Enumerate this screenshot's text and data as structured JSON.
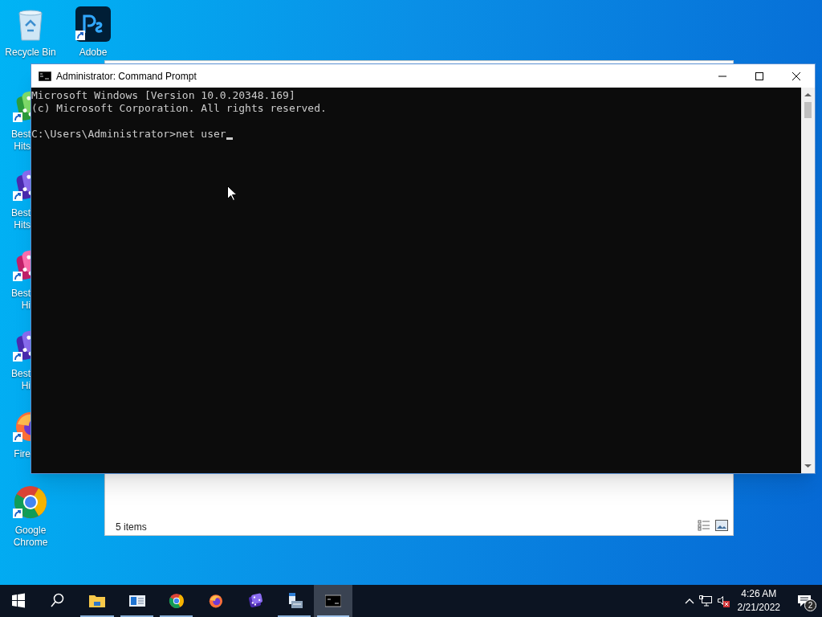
{
  "desktop_icons": [
    {
      "kind": "recycle-bin",
      "lines": [
        "Recycle Bin"
      ]
    },
    {
      "kind": "photoshop",
      "lines": [
        "Adobe"
      ],
      "shortcut": true
    },
    {
      "kind": "dice-green",
      "lines": [
        "Best",
        "Hits"
      ],
      "shortcut": true
    },
    {
      "kind": "dice-purple",
      "lines": [
        "Best",
        "Hits"
      ],
      "shortcut": true
    },
    {
      "kind": "dice-pink",
      "lines": [
        "Best",
        "Hi"
      ],
      "shortcut": true
    },
    {
      "kind": "dice-purple",
      "lines": [
        "Best",
        "Hi"
      ],
      "shortcut": true
    },
    {
      "kind": "firefox",
      "lines": [
        "Fire"
      ],
      "shortcut": true
    },
    {
      "kind": "chrome",
      "lines": [
        "Google",
        "Chrome"
      ],
      "shortcut": true
    }
  ],
  "explorer_window": {
    "status": "5 items"
  },
  "cmd_window": {
    "title": "Administrator: Command Prompt",
    "output": [
      "Microsoft Windows [Version 10.0.20348.169]",
      "(c) Microsoft Corporation. All rights reserved."
    ],
    "prompt": "C:\\Users\\Administrator>net user",
    "cursor": true
  },
  "taskbar": {
    "items": [
      {
        "kind": "start",
        "running": false,
        "selected": false
      },
      {
        "kind": "search",
        "running": false,
        "selected": false
      },
      {
        "kind": "folder",
        "running": true,
        "selected": false
      },
      {
        "kind": "panel",
        "running": true,
        "selected": false
      },
      {
        "kind": "chrome",
        "running": true,
        "selected": false
      },
      {
        "kind": "firefox",
        "running": false,
        "selected": false
      },
      {
        "kind": "dice",
        "running": false,
        "selected": false
      },
      {
        "kind": "server",
        "running": true,
        "selected": false
      },
      {
        "kind": "cmd",
        "running": true,
        "selected": true
      }
    ],
    "time": "4:26 AM",
    "date": "2/21/2022",
    "notifications": "2"
  }
}
